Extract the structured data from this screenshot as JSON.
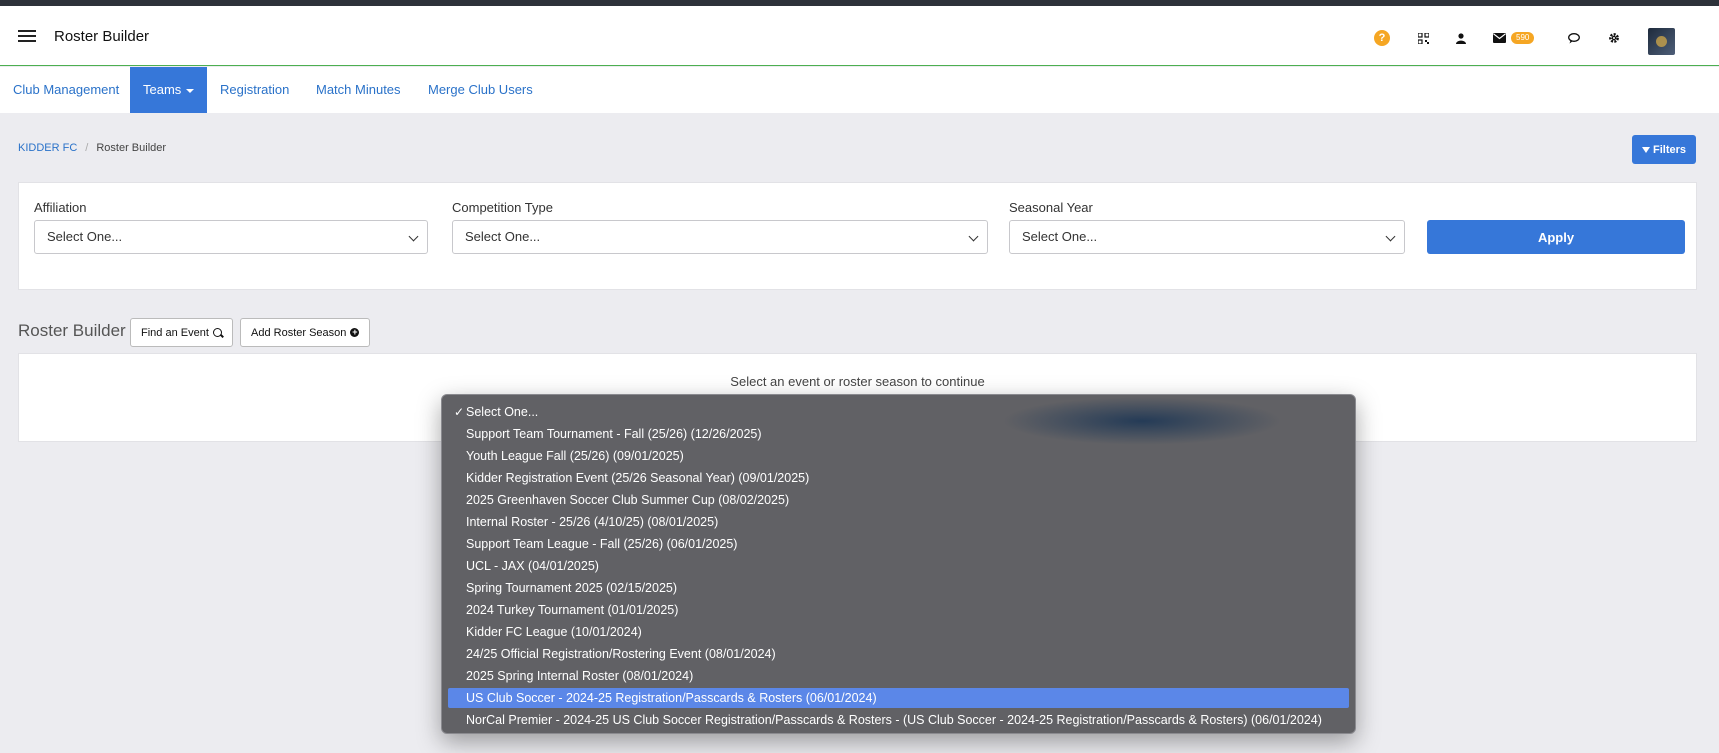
{
  "header": {
    "title": "Roster Builder",
    "mail_count": "590",
    "icons": [
      "help-icon",
      "qr-code-icon",
      "user-icon",
      "mail-icon",
      "chat-icon",
      "gear-icon",
      "avatar"
    ]
  },
  "nav": {
    "items": [
      "Club Management",
      "Teams",
      "Registration",
      "Match Minutes",
      "Merge Club Users"
    ],
    "active": "Teams"
  },
  "breadcrumb": {
    "root": "KIDDER FC",
    "current": "Roster Builder"
  },
  "filters_button": "Filters",
  "filter_panel": {
    "affiliation": {
      "label": "Affiliation",
      "value": "Select One..."
    },
    "competition_type": {
      "label": "Competition Type",
      "value": "Select One..."
    },
    "seasonal_year": {
      "label": "Seasonal Year",
      "value": "Select One..."
    },
    "apply": "Apply"
  },
  "roster_section": {
    "title": "Roster Builder",
    "find_event": "Find an Event",
    "add_roster_season": "Add Roster Season",
    "hint": "Select an event or roster season to continue"
  },
  "dropdown": {
    "checked_index": 0,
    "highlighted_index": 13,
    "options": [
      "Select One...",
      "Support Team Tournament - Fall (25/26) (12/26/2025)",
      "Youth League Fall (25/26) (09/01/2025)",
      "Kidder Registration Event (25/26 Seasonal Year) (09/01/2025)",
      "2025 Greenhaven Soccer Club Summer Cup (08/02/2025)",
      "Internal Roster - 25/26 (4/10/25) (08/01/2025)",
      "Support Team League - Fall (25/26) (06/01/2025)",
      "UCL - JAX (04/01/2025)",
      "Spring Tournament 2025 (02/15/2025)",
      "2024 Turkey Tournament (01/01/2025)",
      "Kidder FC League (10/01/2024)",
      "24/25 Official Registration/Rostering Event (08/01/2024)",
      "2025 Spring Internal Roster (08/01/2024)",
      "US Club Soccer - 2024-25 Registration/Passcards & Rosters (06/01/2024)",
      "NorCal Premier - 2024-25 US Club Soccer Registration/Passcards & Rosters - (US Club Soccer - 2024-25 Registration/Passcards & Rosters) (06/01/2024)"
    ]
  }
}
